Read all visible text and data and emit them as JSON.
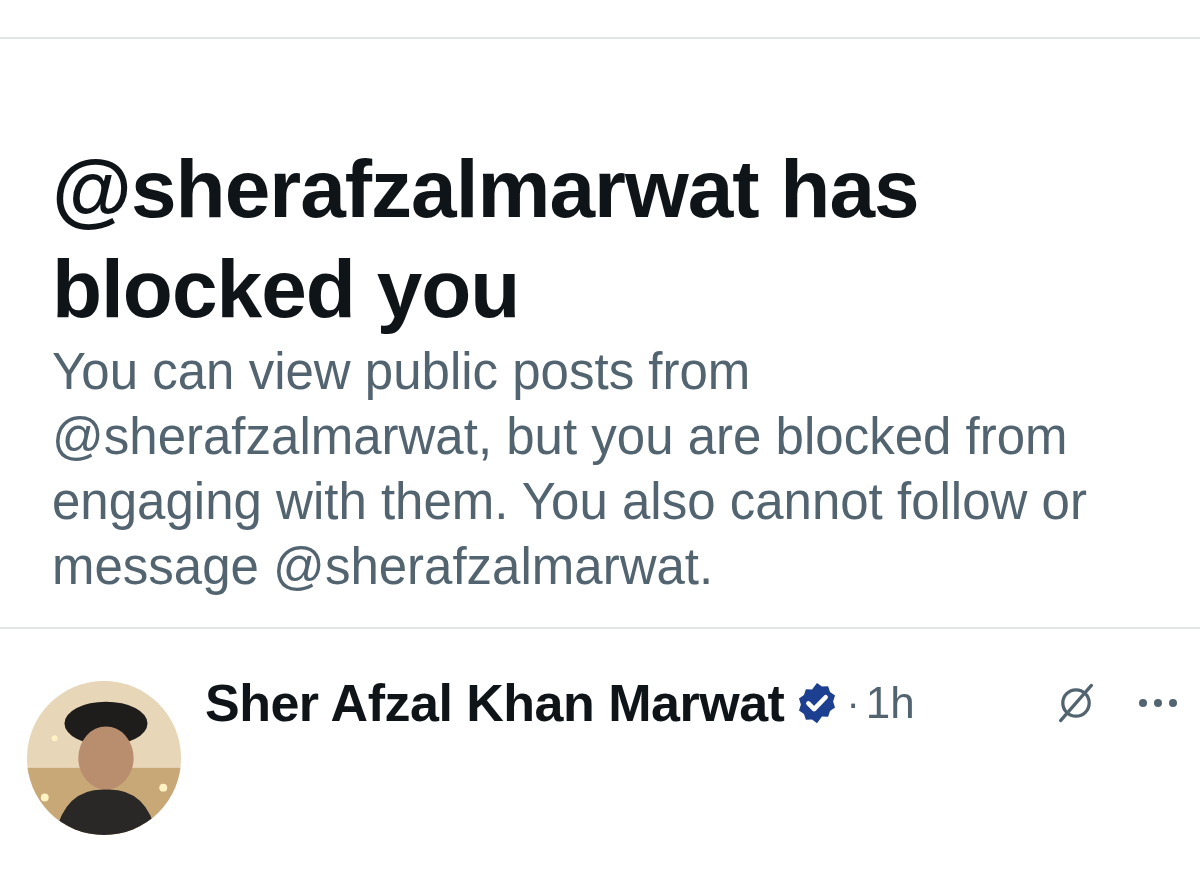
{
  "heading": "@sherafzalmarwat has blocked you",
  "message": "You can view public posts from @sherafzalmarwat, but you are blocked from engaging with them. You also cannot follow or message @sherafzalmarwat.",
  "post": {
    "author": "Sher Afzal Khan Marwat",
    "verified": true,
    "separator": "·",
    "time": "1h"
  }
}
